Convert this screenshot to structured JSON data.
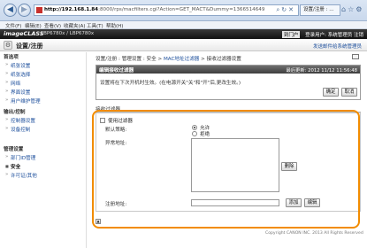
{
  "browser": {
    "url_host": "http://192.168.1.84",
    "url_rest": ":8000/rps/macfilters.cgi?Action=GET_MACT&Dummy=1366514649",
    "tab_title": "设置/注册 : ...",
    "menu": [
      "文件(F)",
      "编辑(E)",
      "查看(V)",
      "收藏夹(A)",
      "工具(T)",
      "帮助(H)"
    ]
  },
  "header": {
    "brand": "imageCLASS",
    "device": "LBP6780x / LBP6780x",
    "portal_link": "到门户",
    "login_text": "登录用户: 系统管理员 注销",
    "page_title": "设置/注册",
    "help_link": "发送邮件给系统管理员"
  },
  "sidebar": {
    "groups": [
      {
        "heading": "首选项",
        "items": [
          "纸张设置",
          "纸张选择",
          "网络",
          "界面设置",
          "用户维护管理"
        ]
      },
      {
        "heading": "输出/控制",
        "items": [
          "控制器设置",
          "设备控制"
        ]
      },
      {
        "heading": "管理设置",
        "items": [
          "部门ID管理",
          "安全",
          "许可证/其他"
        ]
      }
    ],
    "active_item": "安全"
  },
  "main": {
    "breadcrumb_prefix": "设置/注册 : 管理设置 : 安全 > ",
    "breadcrumb_mid": "MAC地址过滤器",
    "breadcrumb_end": " > 接收过滤器设置",
    "panel_title": "编辑接收过滤器",
    "last_updated": "最后更新: 2012 11/12 11:56:48",
    "notice": "设置将在下次开机时生效。(在电源开关\"关\"和\"开\"后,更改生效。)",
    "ok_label": "确定",
    "cancel_label": "取消",
    "section_label": "接收过滤器",
    "use_filter_label": "使用过滤器",
    "use_filter_checked": false,
    "default_policy_label": "默认策略:",
    "radio_allow": "允许",
    "radio_reject": "拒绝",
    "selected_policy": "允许",
    "exception_label": "异常地址:",
    "delete_label": "删除",
    "register_label": "注册地址:",
    "register_value": "",
    "add_label": "添加",
    "edit_label": "编辑",
    "copyright": "Copyright CANON INC. 2013 All Rights Reserved"
  }
}
